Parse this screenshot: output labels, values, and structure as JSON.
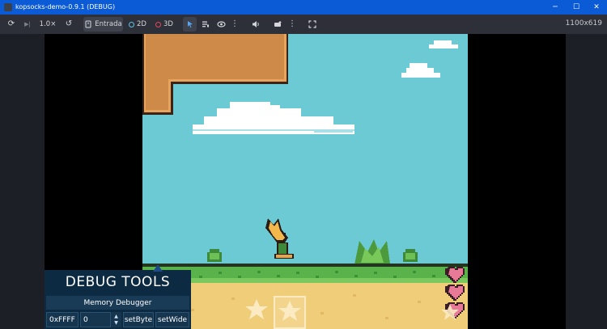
{
  "window": {
    "title": "kopsocks-demo-0.9.1 (DEBUG)",
    "controls": {
      "minimize": "─",
      "maximize": "☐",
      "close": "✕"
    }
  },
  "toolbar": {
    "speed": "1.0×",
    "entrada_label": "Entrada",
    "two_d_label": "2D",
    "three_d_label": "3D",
    "resolution": "1100x619",
    "icons": {
      "refresh": "⟳",
      "step": "▶|",
      "reset": "↺",
      "more": "⋮",
      "sound": "🔊",
      "fullscreen": "⛶"
    }
  },
  "debug_tools": {
    "title": "DEBUG TOOLS",
    "panel": "Memory Debugger",
    "address": "0xFFFF",
    "value": "0",
    "stepper_up": "▲",
    "stepper_down": "▼",
    "set_byte": "setByte",
    "set_wide": "setWide"
  },
  "game": {
    "hearts": 3,
    "stars": 2,
    "colors": {
      "sky": "#6ccad4",
      "grass": "#59b24a",
      "sand": "#f0cd78",
      "block": "#cd8a48",
      "heart": "#e77a96"
    }
  }
}
